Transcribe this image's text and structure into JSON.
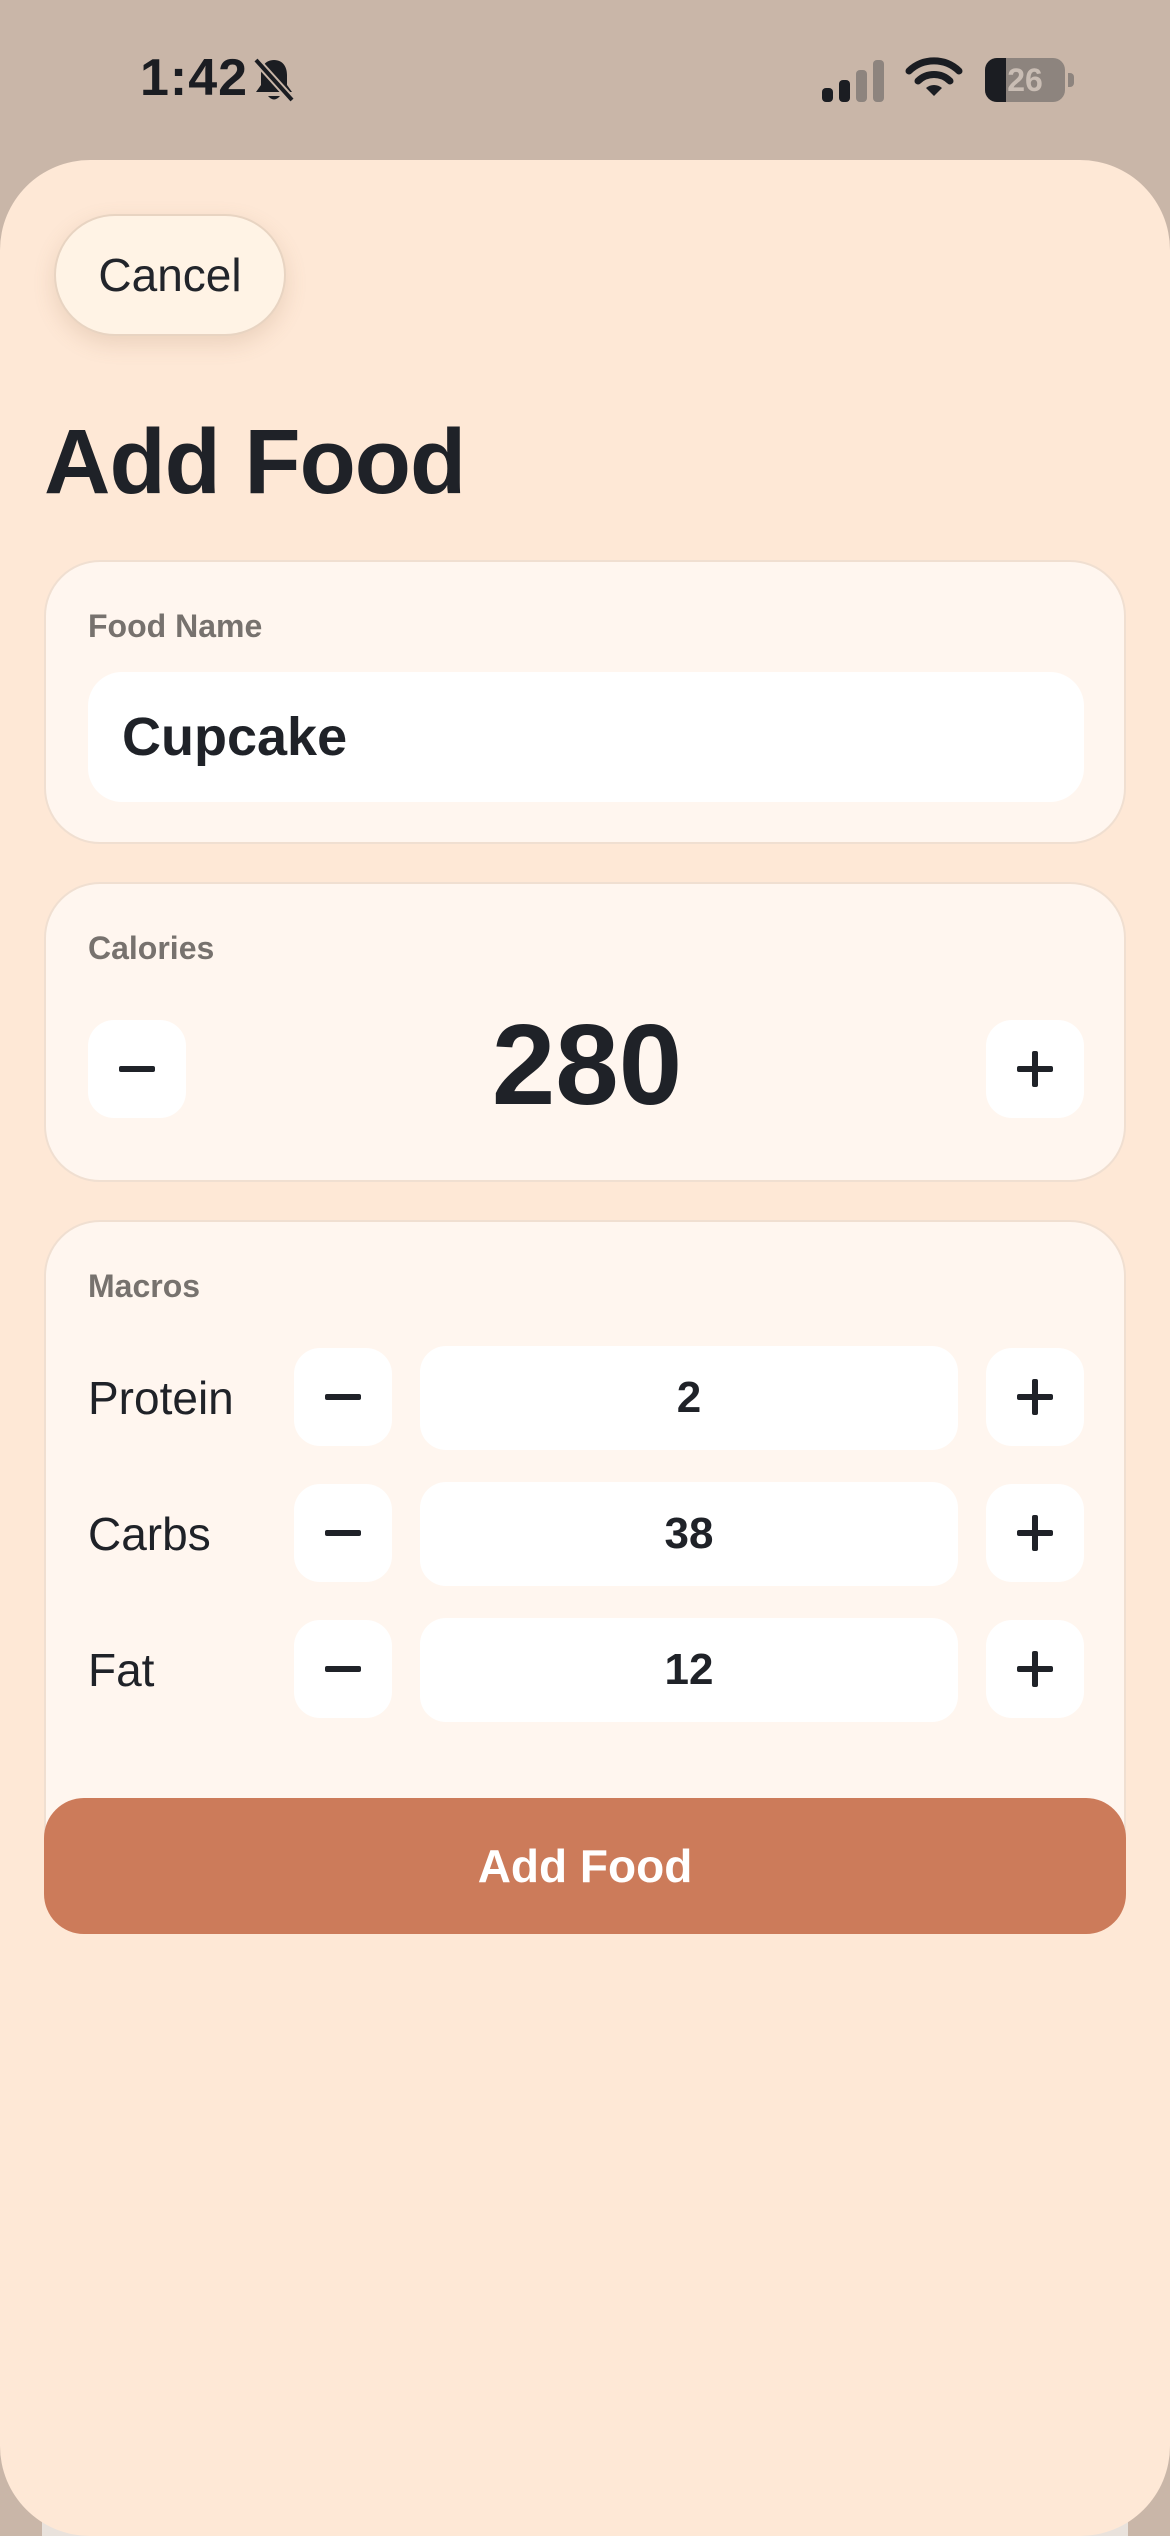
{
  "status_bar": {
    "time": "1:42",
    "battery_level": "26",
    "battery_fraction": 0.26
  },
  "header": {
    "cancel_label": "Cancel",
    "title": "Add Food"
  },
  "food_name": {
    "label": "Food Name",
    "value": "Cupcake"
  },
  "calories": {
    "label": "Calories",
    "value": "280"
  },
  "macros": {
    "label": "Macros",
    "rows": [
      {
        "label": "Protein",
        "value": "2"
      },
      {
        "label": "Carbs",
        "value": "38"
      },
      {
        "label": "Fat",
        "value": "12"
      }
    ]
  },
  "actions": {
    "add_label": "Add Food"
  },
  "colors": {
    "accent": "#cc7b5a",
    "sheet_background": "#fee8d6",
    "card_background": "#fff6ef",
    "text": "#1f2228"
  },
  "icons": [
    "bell-slash-icon",
    "signal-icon",
    "wifi-icon",
    "battery-icon",
    "minus-icon",
    "plus-icon"
  ]
}
